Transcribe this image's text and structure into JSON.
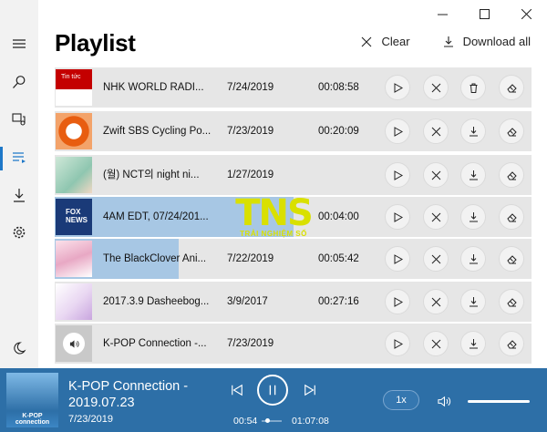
{
  "window": {
    "title": "Playlist"
  },
  "actions": {
    "clear": "Clear",
    "download_all": "Download all"
  },
  "rail": [
    "hamburger-icon",
    "search-icon",
    "podcast-icon",
    "playlist-icon",
    "download-icon",
    "settings-icon",
    "night-mode-icon"
  ],
  "rows": [
    {
      "title": "NHK WORLD RADI...",
      "date": "7/24/2019",
      "duration": "00:08:58",
      "thumb_label": "Tin tức",
      "third_action": "trash-icon",
      "progress": 0.0
    },
    {
      "title": "Zwift SBS Cycling Po...",
      "date": "7/23/2019",
      "duration": "00:20:09",
      "thumb_label": "",
      "third_action": "download-icon",
      "progress": 0.0
    },
    {
      "title": "(월) NCT의 night ni...",
      "date": "1/27/2019",
      "duration": "",
      "thumb_label": "",
      "third_action": "download-icon",
      "progress": 0.0
    },
    {
      "title": "4AM EDT, 07/24/201...",
      "date": "",
      "duration": "00:04:00",
      "thumb_label": "FOX NEWS",
      "third_action": "download-icon",
      "progress": 0.5
    },
    {
      "title": "The BlackClover Ani...",
      "date": "7/22/2019",
      "duration": "00:05:42",
      "thumb_label": "",
      "third_action": "download-icon",
      "progress": 0.26
    },
    {
      "title": "2017.3.9 Dasheebog...",
      "date": "3/9/2017",
      "duration": "00:27:16",
      "thumb_label": "",
      "third_action": "download-icon",
      "progress": 0.0
    },
    {
      "title": "K-POP Connection -...",
      "date": "7/23/2019",
      "duration": "",
      "thumb_label": "",
      "third_action": "download-icon",
      "progress": 0.0
    }
  ],
  "watermark": {
    "main": "TNS",
    "sub": "TRẢI NGHIỆM SỐ"
  },
  "player": {
    "title": "K-POP Connection - 2019.07.23",
    "date": "7/23/2019",
    "elapsed": "00:54",
    "total": "01:07:08",
    "speed": "1x",
    "thumb_label": "K-POP connection"
  },
  "colors": {
    "accent": "#1e78c8",
    "player_bg": "#2d6fa7",
    "selection": "#a7c7e4",
    "row_bg": "#e6e6e6"
  }
}
